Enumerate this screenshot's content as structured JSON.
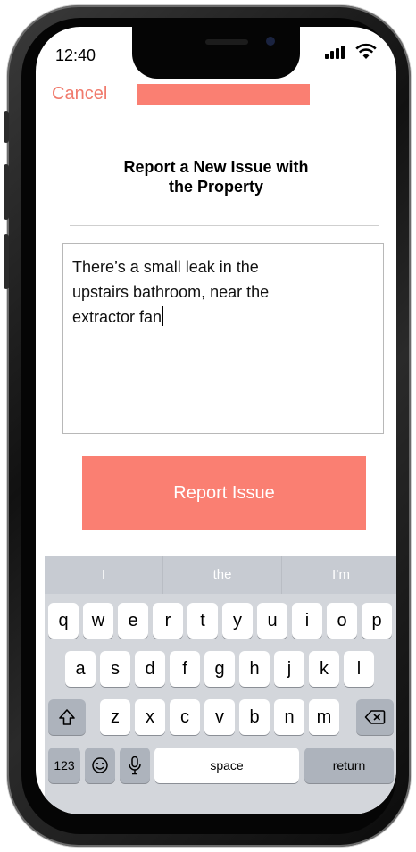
{
  "status_bar": {
    "time": "12:40"
  },
  "nav": {
    "cancel_label": "Cancel"
  },
  "heading": {
    "line1": "Report a New Issue with",
    "line2": "the Property"
  },
  "issue_field": {
    "line1": "There’s a small leak in the",
    "line2": "upstairs bathroom, near the",
    "line3": "extractor fan"
  },
  "report_button": {
    "label": "Report Issue"
  },
  "keyboard": {
    "suggestions": [
      "I",
      "the",
      "I’m"
    ],
    "row1": [
      "q",
      "w",
      "e",
      "r",
      "t",
      "y",
      "u",
      "i",
      "o",
      "p"
    ],
    "row2": [
      "a",
      "s",
      "d",
      "f",
      "g",
      "h",
      "j",
      "k",
      "l"
    ],
    "row3": [
      "z",
      "x",
      "c",
      "v",
      "b",
      "n",
      "m"
    ],
    "numbers_label": "123",
    "space_label": "space",
    "return_label": "return"
  },
  "colors": {
    "accent": "#fa7f72",
    "cancel_text": "#f07a6c",
    "keyboard_bg": "#d3d6db"
  }
}
